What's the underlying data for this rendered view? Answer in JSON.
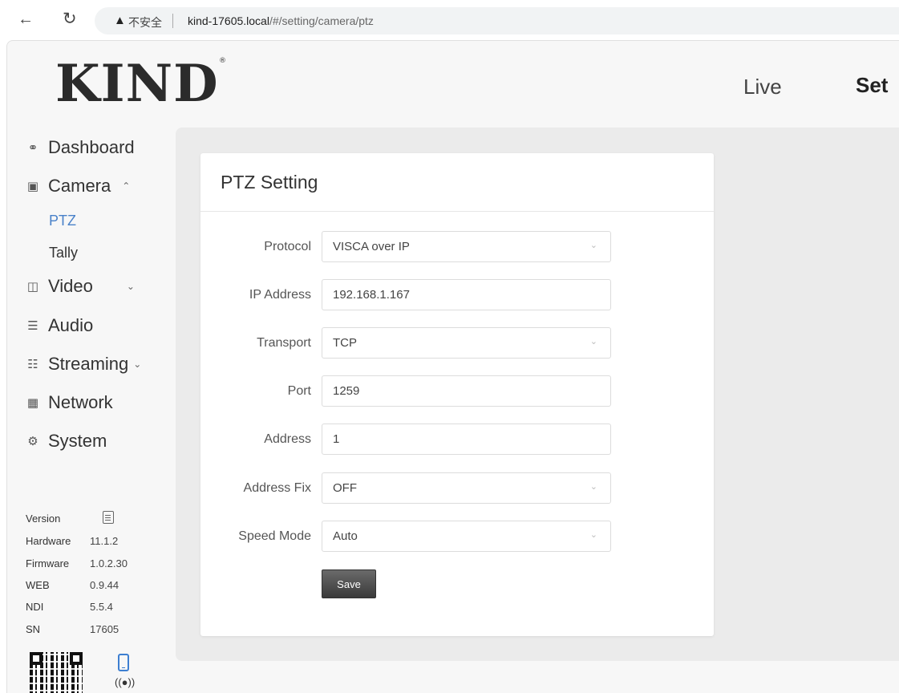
{
  "browser": {
    "security_warning": "不安全",
    "url_host": "kind-17605.local",
    "url_path": "/#/setting/camera/ptz"
  },
  "header": {
    "logo": "KIND",
    "logo_mark": "®",
    "nav_live": "Live",
    "nav_settings": "Set"
  },
  "sidebar": {
    "dashboard": "Dashboard",
    "camera": "Camera",
    "camera_sub": [
      "PTZ",
      "Tally"
    ],
    "video": "Video",
    "audio": "Audio",
    "streaming": "Streaming",
    "network": "Network",
    "system": "System",
    "active_sub": "PTZ",
    "accent_color": "#4a82c9"
  },
  "version_info": {
    "title": "Version",
    "rows": [
      {
        "key": "Hardware",
        "value": "11.1.2"
      },
      {
        "key": "Firmware",
        "value": "1.0.2.30"
      },
      {
        "key": "WEB",
        "value": "0.9.44"
      },
      {
        "key": "NDI",
        "value": "5.5.4"
      },
      {
        "key": "SN",
        "value": "17605"
      }
    ]
  },
  "ptz": {
    "title": "PTZ Setting",
    "fields": {
      "protocol": {
        "label": "Protocol",
        "value": "VISCA over IP"
      },
      "ip_address": {
        "label": "IP Address",
        "value": "192.168.1.167"
      },
      "transport": {
        "label": "Transport",
        "value": "TCP"
      },
      "port": {
        "label": "Port",
        "value": "1259"
      },
      "address": {
        "label": "Address",
        "value": "1"
      },
      "address_fix": {
        "label": "Address Fix",
        "value": "OFF"
      },
      "speed_mode": {
        "label": "Speed Mode",
        "value": "Auto"
      }
    },
    "save_label": "Save"
  }
}
